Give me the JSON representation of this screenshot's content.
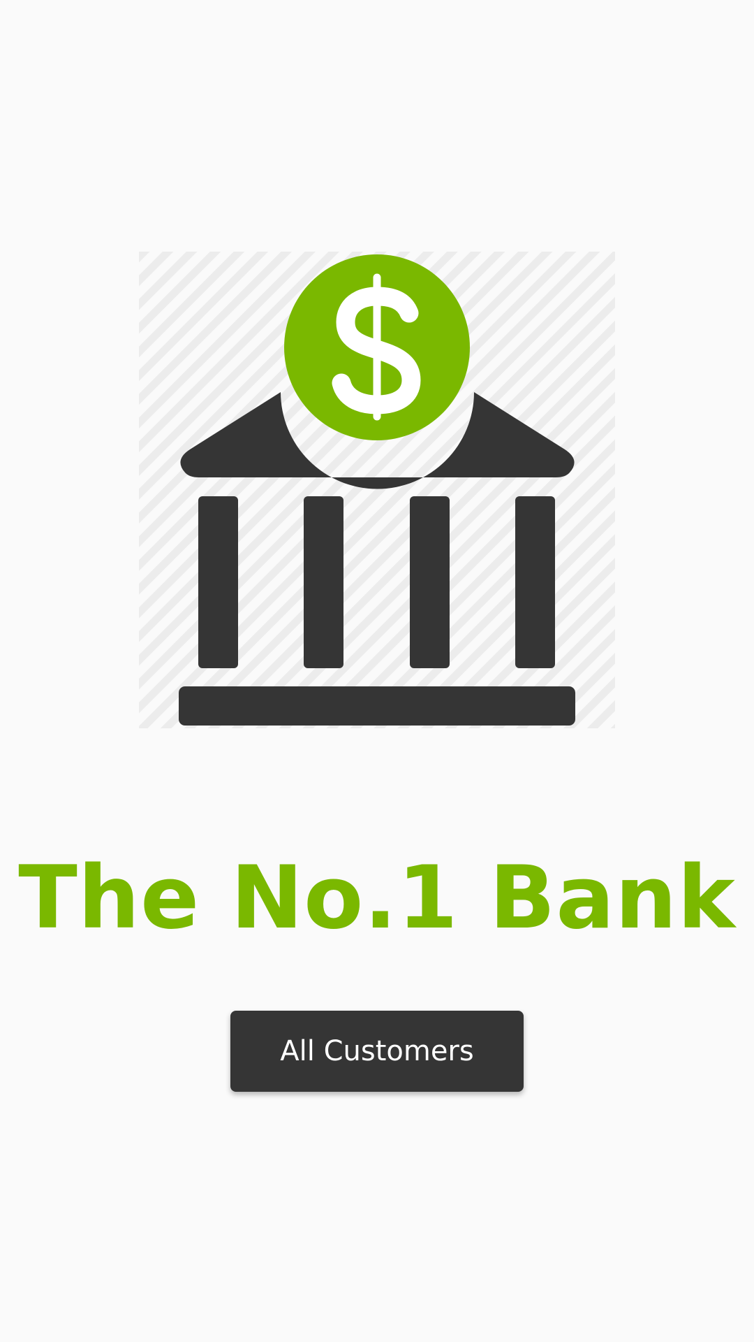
{
  "brand": {
    "tagline": "The No.1 Bank",
    "accent_color": "#7ab800",
    "dark_color": "#353535",
    "logo_icon": "bank-with-dollar-coin-icon"
  },
  "actions": {
    "all_customers_label": "All Customers"
  }
}
